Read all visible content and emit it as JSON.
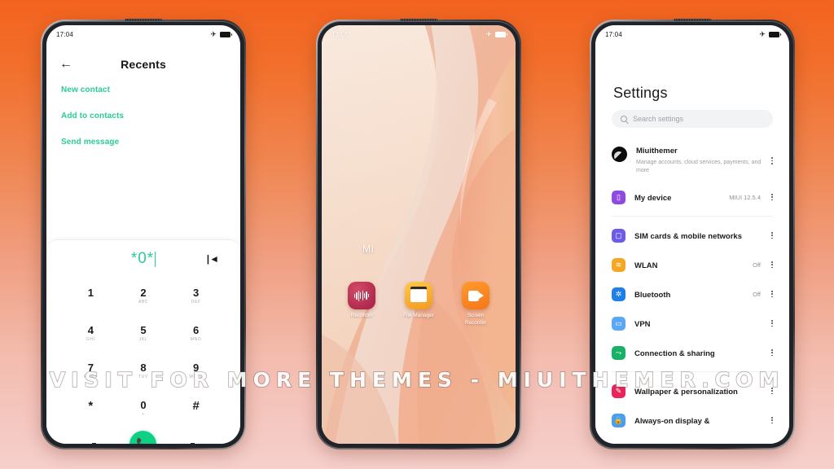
{
  "background": {
    "top_color": "#f2631f",
    "bottom_color": "#f6cfcb"
  },
  "watermark": {
    "text": "VISIT FOR MORE THEMES - MIUITHEMER.COM"
  },
  "phones": {
    "dialer": {
      "status": {
        "time": "17:04",
        "airplane_icon": "airplane-icon",
        "battery_icon": "battery-icon"
      },
      "header": {
        "back_icon": "back-arrow-icon",
        "title": "Recents"
      },
      "actions": [
        {
          "label": "New contact"
        },
        {
          "label": "Add to contacts"
        },
        {
          "label": "Send message"
        }
      ],
      "display": {
        "number": "*0*",
        "backspace_icon": "backspace-icon"
      },
      "accent_color": "#29ce94",
      "keypad": [
        {
          "digit": "1",
          "letters": ""
        },
        {
          "digit": "2",
          "letters": "ABC"
        },
        {
          "digit": "3",
          "letters": "DEF"
        },
        {
          "digit": "4",
          "letters": "GHI"
        },
        {
          "digit": "5",
          "letters": "JKL"
        },
        {
          "digit": "6",
          "letters": "MNO"
        },
        {
          "digit": "7",
          "letters": "PQRS"
        },
        {
          "digit": "8",
          "letters": "TUV"
        },
        {
          "digit": "9",
          "letters": "WXYZ"
        },
        {
          "digit": "*",
          "letters": ""
        },
        {
          "digit": "0",
          "letters": "+"
        },
        {
          "digit": "#",
          "letters": ""
        }
      ],
      "bottom": {
        "left_icon": "keyboard-hide-icon",
        "call_icon": "phone-call-icon",
        "right_icon": "more-options-icon",
        "call_button_color": "#0ed184"
      }
    },
    "home": {
      "status": {
        "time": "17:05",
        "airplane_icon": "airplane-icon",
        "battery_icon": "battery-icon"
      },
      "folder_label": "Mi",
      "apps": [
        {
          "label": "Recorder",
          "icon": "recorder-icon",
          "color": "#a41f46"
        },
        {
          "label": "File Manager",
          "icon": "file-manager-icon",
          "color": "#f39a21"
        },
        {
          "label": "Screen Recorder",
          "icon": "screen-recorder-icon",
          "color": "#f5761a"
        }
      ]
    },
    "settings": {
      "status": {
        "time": "17:04",
        "airplane_icon": "airplane-icon",
        "battery_icon": "battery-icon"
      },
      "title": "Settings",
      "search": {
        "placeholder": "Search settings",
        "icon": "search-icon"
      },
      "account": {
        "name": "Miuithemer",
        "subtitle": "Manage accounts, cloud services, payments, and more",
        "avatar": "account-avatar"
      },
      "items": [
        {
          "label": "My device",
          "value": "MIUI 12.5.4",
          "icon": "device-icon",
          "color": "#8f4ae0",
          "group": 1
        },
        {
          "label": "SIM cards & mobile networks",
          "value": "",
          "icon": "sim-card-icon",
          "color": "#6d5ce7",
          "group": 2
        },
        {
          "label": "WLAN",
          "value": "Off",
          "icon": "wifi-icon",
          "color": "#f5a623",
          "group": 2
        },
        {
          "label": "Bluetooth",
          "value": "Off",
          "icon": "bluetooth-icon",
          "color": "#1d7fe8",
          "group": 2
        },
        {
          "label": "VPN",
          "value": "",
          "icon": "vpn-icon",
          "color": "#5aa8f5",
          "group": 2
        },
        {
          "label": "Connection & sharing",
          "value": "",
          "icon": "connection-sharing-icon",
          "color": "#19b264",
          "group": 2
        },
        {
          "label": "Wallpaper & personalization",
          "value": "",
          "icon": "wallpaper-icon",
          "color": "#e8245c",
          "group": 3
        },
        {
          "label": "Always-on display &",
          "value": "",
          "icon": "lock-screen-icon",
          "color": "#4a9ef0",
          "group": 3
        }
      ],
      "kebab_icon": "more-vertical-icon"
    }
  }
}
